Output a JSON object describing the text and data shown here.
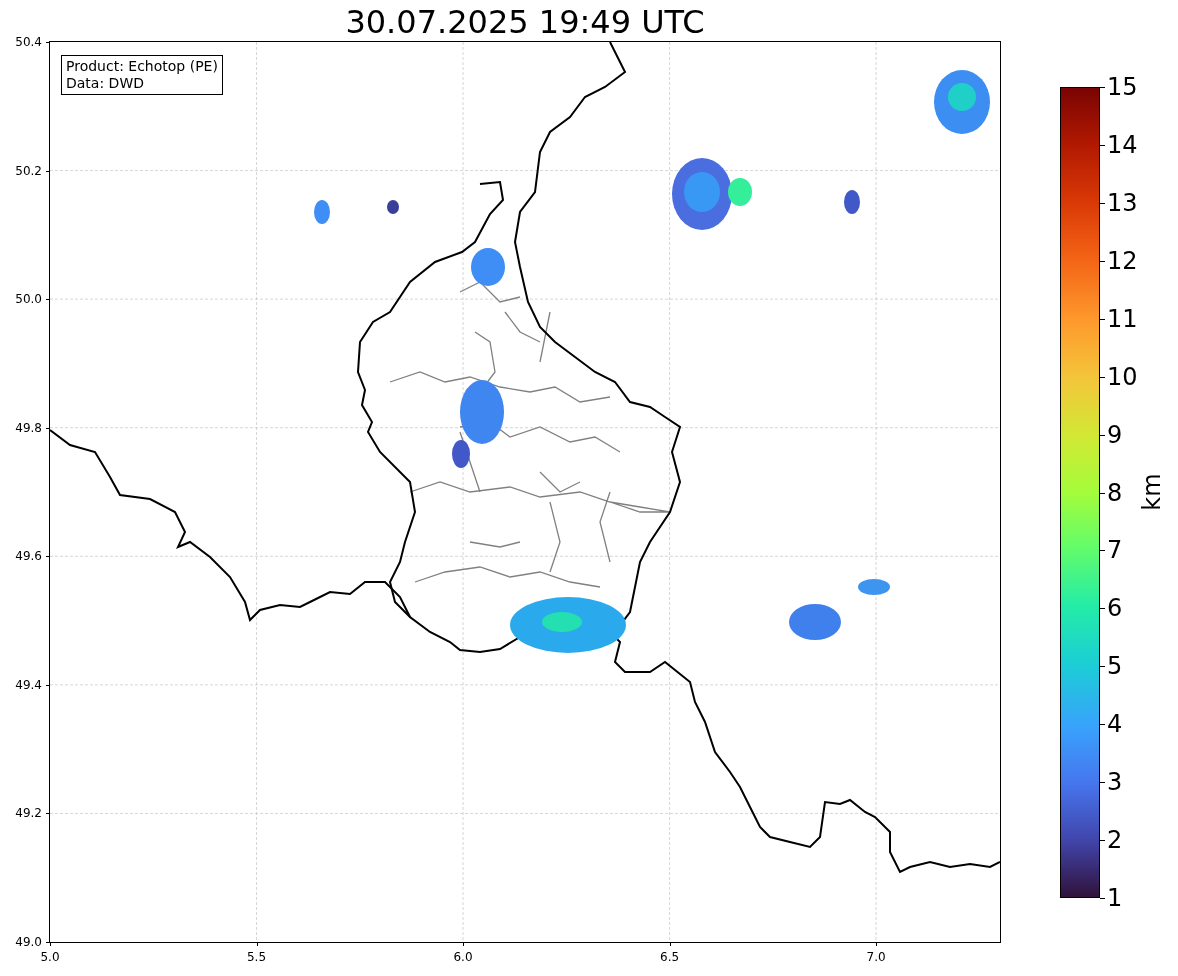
{
  "title": "30.07.2025 19:49 UTC",
  "info_box": {
    "lines": [
      "Product: Echotop (PE)",
      "Data: DWD"
    ]
  },
  "map": {
    "x_ticks": [
      "5.0",
      "5.5",
      "6.0",
      "6.5",
      "7.0"
    ],
    "y_ticks": [
      "50.4",
      "50.2",
      "50.0",
      "49.8",
      "49.6",
      "49.4",
      "49.2",
      "49.0"
    ]
  },
  "colorbar": {
    "label": "km",
    "ticks": [
      "15",
      "14",
      "13",
      "12",
      "11",
      "10",
      "9",
      "8",
      "7",
      "6",
      "5",
      "4",
      "3",
      "2",
      "1"
    ]
  }
}
